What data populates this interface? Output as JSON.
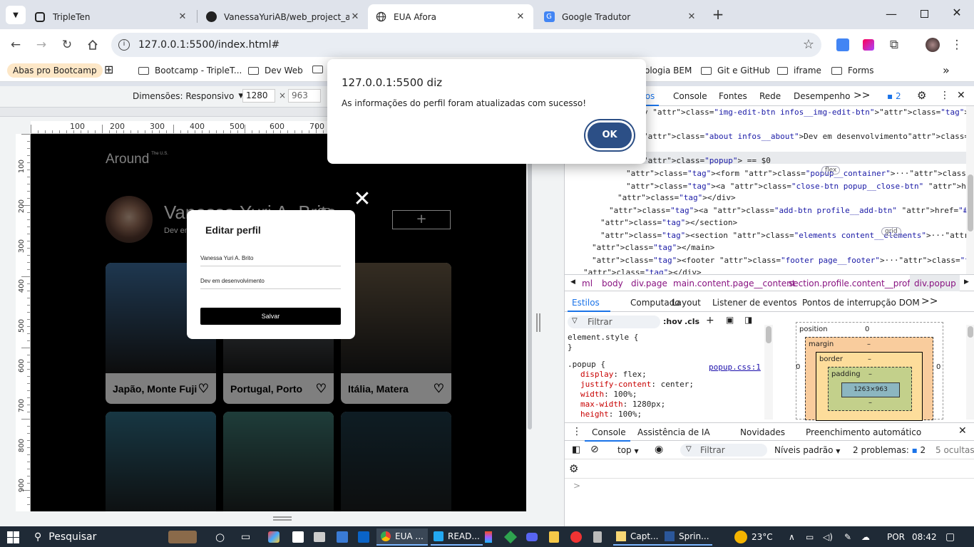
{
  "browser": {
    "tabs": [
      {
        "title": "TripleTen",
        "icon": "tripleten-icon",
        "active": false
      },
      {
        "title": "VanessaYuriAB/web_project_aro",
        "icon": "github-icon",
        "active": false
      },
      {
        "title": "EUA Afora",
        "icon": "globe-icon",
        "active": true
      },
      {
        "title": "Google Tradutor",
        "icon": "translate-icon",
        "active": false
      }
    ],
    "url": "127.0.0.1:5500/index.html#",
    "bookmarks": [
      {
        "label": "Abas pro Bootcamp",
        "folder": false
      },
      {
        "label": "Bootcamp - TripleT...",
        "folder": true
      },
      {
        "label": "Dev Web",
        "folder": true
      },
      {
        "label": "ologia BEM",
        "folder": false
      },
      {
        "label": "Git e GitHub",
        "folder": true
      },
      {
        "label": "iframe",
        "folder": true
      },
      {
        "label": "Forms",
        "folder": true
      }
    ]
  },
  "dialog": {
    "origin": "127.0.0.1:5500 diz",
    "message": "As informações do perfil foram atualizadas com sucesso!",
    "ok": "OK"
  },
  "device_toolbar": {
    "label": "Dimensões: Responsivo",
    "width": "1280",
    "times": "×",
    "height": "963"
  },
  "rulers": {
    "h": [
      "100",
      "200",
      "300",
      "400",
      "500",
      "600",
      "700"
    ],
    "v": [
      "100",
      "200",
      "300",
      "400",
      "500",
      "600",
      "700",
      "800",
      "900"
    ]
  },
  "site": {
    "logo": "Around",
    "logo_sup": "The U.S.",
    "profile_name": "Vanessa Yuri A. Brito",
    "profile_about": "Dev em desenvolvimento",
    "add_button": "+",
    "popup": {
      "title": "Editar perfil",
      "name_value": "Vanessa Yuri A. Brito",
      "about_value": "Dev em desenvolvimento",
      "save": "Salvar",
      "close": "✕"
    },
    "cards": [
      {
        "caption": "Japão, Monte Fuji",
        "color": "#3d6fa0"
      },
      {
        "caption": "Portugal, Porto",
        "color": "#7f8a95"
      },
      {
        "caption": "Itália, Matera",
        "color": "#6a5a45"
      },
      {
        "caption": "",
        "color": "#2f6e86"
      },
      {
        "caption": "",
        "color": "#3e7a74"
      },
      {
        "caption": "",
        "color": "#1c3a48"
      }
    ]
  },
  "devtools": {
    "tabs": [
      "tos",
      "Console",
      "Fontes",
      "Rede",
      "Desempenho",
      ">>"
    ],
    "issues_count": "2",
    "dom": [
      {
        "pre": "v ",
        "tag": "div",
        "attr": "class",
        "val": "img-edit-btn infos__img-edit-btn",
        "post": "</div>"
      },
      {
        "pre": "",
        "tag": "h2",
        "attr": "class",
        "val": "about infos__about",
        "post": "Dev em desenvolvimento</h2>"
      },
      {
        "pre": "",
        "tag": "div",
        "attr": "class",
        "val": "popup",
        "post": " == $0"
      },
      {
        "pre": "▶ ",
        "tag": "form",
        "attr": "class",
        "val": "popup__container",
        "post": "</form>"
      },
      {
        "pre": "▶ ",
        "tag": "a",
        "attr": "class",
        "val": "close-btn popup__close-btn",
        "post": "</a>"
      },
      {
        "pre": "",
        "tag": "",
        "attr": "",
        "val": "",
        "post": "</div>"
      },
      {
        "pre": "▶ ",
        "tag": "a",
        "attr": "class",
        "val": "add-btn profile__add-btn",
        "post": "</a>"
      },
      {
        "pre": "",
        "tag": "",
        "attr": "",
        "val": "",
        "post": "</section>"
      },
      {
        "pre": "▶ ",
        "tag": "section",
        "attr": "class",
        "val": "elements content__elements",
        "post": "</section>"
      },
      {
        "pre": "",
        "tag": "",
        "attr": "",
        "val": "",
        "post": "</main>"
      },
      {
        "pre": "▶ ",
        "tag": "footer",
        "attr": "class",
        "val": "footer page__footer",
        "post": "</footer>"
      },
      {
        "pre": "",
        "tag": "",
        "attr": "",
        "val": "",
        "post": "</div>"
      }
    ],
    "dom_lines": [
      "v class=\"img-edit-btn infos__img-edit-btn\"></div>",
      "class=\"about infos__about\">Dev em desenvolvimento</h2>",
      "class=\"popup\"> == $0",
      "<form class=\"popup__container\">···</form>",
      "<a class=\"close-btn popup__close-btn\" href=\"#\">···</a>",
      "</div>",
      "<a class=\"add-btn profile__add-btn\" href=\"#\">···</a>",
      "</section>",
      "<section class=\"elements content__elements\">···</section>",
      "</main>",
      "<footer class=\"footer page__footer\">···</footer>",
      "</div>"
    ],
    "pills": {
      "flex": "flex",
      "grid": "grid"
    },
    "breadcrumbs": [
      "ml",
      "body",
      "div.page",
      "main.content.page__content",
      "section.profile.content__profile",
      "div.popup"
    ],
    "styles_tabs": [
      "Estilos",
      "Computado",
      "Layout",
      "Listener de eventos",
      "Pontos de interrupção DOM",
      ">>"
    ],
    "filter_placeholder": "Filtrar",
    "hov": ":hov",
    "cls": ".cls",
    "css_lines": [
      "element.style {",
      "}",
      ".popup {",
      "display: flex;",
      "justify-content: center;",
      "width: 100%;",
      "max-width: 1280px;",
      "height: 100%;"
    ],
    "css_source": "popup.css:1",
    "box": {
      "position_label": "position",
      "position_value": "0",
      "margin_label": "margin",
      "border_label": "border",
      "padding_label": "padding",
      "dash": "–",
      "content": "1263×963",
      "zero": "0"
    },
    "drawer_tabs": [
      "Console",
      "Assistência de IA",
      "Novidades",
      "Preenchimento automático"
    ],
    "console_top": "top",
    "console_filter": "Filtrar",
    "console_levels": "Níveis padrão",
    "problems_label": "2 problemas:",
    "problems_count": "2",
    "hidden": "5 ocultas",
    "prompt": ">"
  },
  "taskbar": {
    "search": "Pesquisar",
    "items": [
      "EUA ...",
      "READ...",
      "Capt...",
      "Sprin..."
    ],
    "temp": "23°C",
    "lang": "POR",
    "time": "08:42"
  }
}
